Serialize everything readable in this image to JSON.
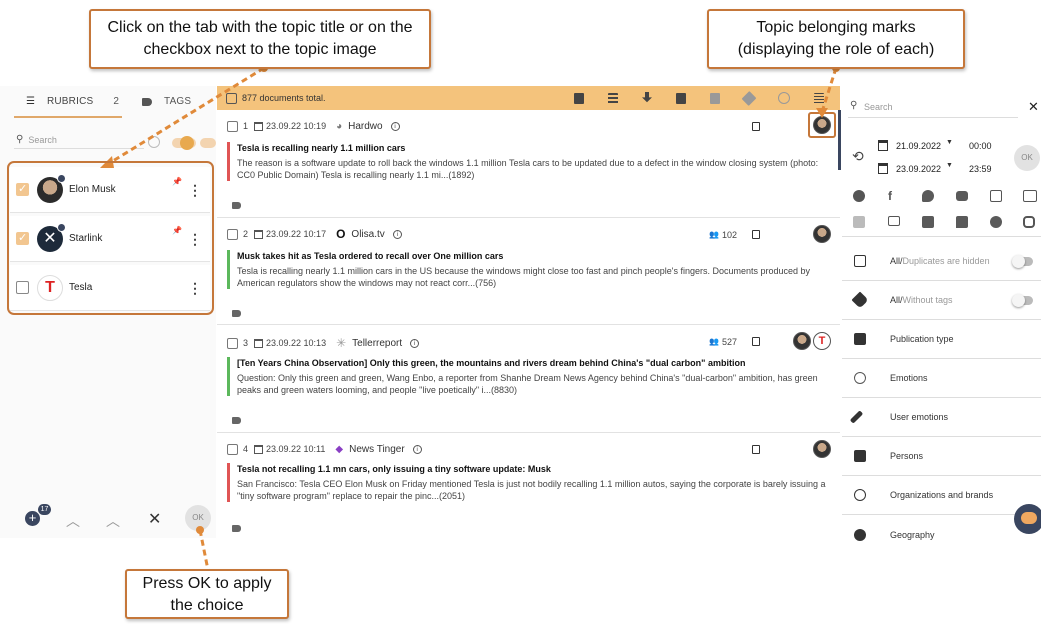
{
  "callouts": {
    "top_left": "Click on the tab with the topic title or on the checkbox next to the topic image",
    "top_right": "Topic belonging marks (displaying the role of each)",
    "bottom": "Press OK to apply the choice"
  },
  "left": {
    "tabs": [
      {
        "label": "RUBRICS",
        "count": "2"
      },
      {
        "label": "TAGS"
      }
    ],
    "search_placeholder": "Search",
    "rubrics": [
      {
        "name": "Elon Musk",
        "checked": true
      },
      {
        "name": "Starlink",
        "checked": true
      },
      {
        "name": "Tesla",
        "checked": false
      }
    ],
    "bottom_bar": {
      "add_badge": "17",
      "ok_label": "OK"
    }
  },
  "center": {
    "total": "877 documents total.",
    "docs": [
      {
        "num": "1",
        "date": "23.09.22 10:19",
        "source": "Hardwo",
        "title": "Tesla is recalling nearly 1.1 million cars",
        "text": "The reason is a software update to roll back the windows 1.1 million Tesla cars to be updated due to a defect in the window closing system (photo: CC0 Public Domain) Tesla is recalling nearly 1.1 mi...(1892)",
        "bar_color": "#e05555",
        "audience": ""
      },
      {
        "num": "2",
        "date": "23.09.22 10:17",
        "source": "Olisa.tv",
        "title": "Musk takes hit as Tesla ordered to recall over One million cars",
        "text": "Tesla is recalling nearly 1.1 million cars in the US because the windows might close too fast and pinch people's fingers. Documents produced by American regulators show the windows may not react corr...(756)",
        "bar_color": "#5cb85c",
        "audience": "102"
      },
      {
        "num": "3",
        "date": "23.09.22 10:13",
        "source": "Tellerreport",
        "title": "[Ten Years China Observation] Only this green, the mountains and rivers dream behind China's \"dual carbon\" ambition",
        "text": "Question: Only this green and green, Wang Enbo, a reporter from Shanhe Dream News Agency behind China's \"dual-carbon\" ambition, has green peaks and green waters looming, and people \"live poetically\" i...(8830)",
        "bar_color": "#5cb85c",
        "audience": "527"
      },
      {
        "num": "4",
        "date": "23.09.22 10:11",
        "source": "News Tinger",
        "title": "Tesla not recalling 1.1 mn cars, only issuing a tiny software update: Musk",
        "text": "San Francisco: Tesla CEO Elon Musk on Friday mentioned Tesla is just not bodily recalling 1.1 million autos, saying the corporate is barely issuing a \"tiny software program\" replace to repair the pinc...(2051)",
        "bar_color": "#e05555",
        "audience": ""
      }
    ]
  },
  "right": {
    "search_placeholder": "Search",
    "date_from": "21.09.2022",
    "time_from": "00:00",
    "date_to": "23.09.2022",
    "time_to": "23:59",
    "ok_label": "OK",
    "filters": [
      {
        "main": "All/",
        "muted": "Duplicates are hidden",
        "toggle": true,
        "icon": "duplicates-icon"
      },
      {
        "main": "All/",
        "muted": "Without tags",
        "toggle": true,
        "icon": "tag-icon"
      },
      {
        "main": "Publication type",
        "muted": "",
        "toggle": false,
        "icon": "publication-type-icon"
      },
      {
        "main": "Emotions",
        "muted": "",
        "toggle": false,
        "icon": "emotions-icon"
      },
      {
        "main": "User emotions",
        "muted": "",
        "toggle": false,
        "icon": "wrench-icon"
      },
      {
        "main": "Persons",
        "muted": "",
        "toggle": false,
        "icon": "persons-icon"
      },
      {
        "main": "Organizations and brands",
        "muted": "",
        "toggle": false,
        "icon": "copyright-icon"
      },
      {
        "main": "Geography",
        "muted": "",
        "toggle": false,
        "icon": "compass-icon"
      }
    ]
  },
  "colors": {
    "accent": "#f4c37c",
    "callout_border": "#c5773a",
    "red_bar": "#e05555",
    "green_bar": "#5cb85c"
  }
}
